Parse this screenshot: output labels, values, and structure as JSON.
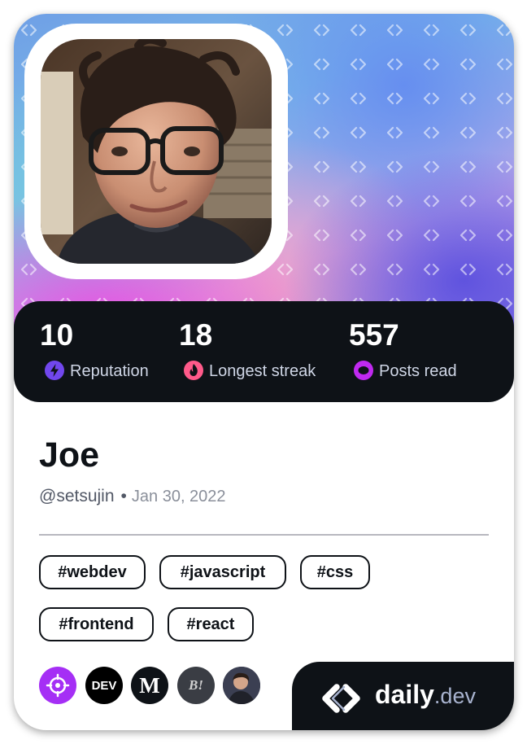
{
  "profile": {
    "name": "Joe",
    "handle": "@setsujin",
    "separator": "•",
    "joined": "Jan 30, 2022"
  },
  "stats": [
    {
      "value": "10",
      "label": "Reputation",
      "icon": "lightning-icon",
      "icon_color": "#7147ed"
    },
    {
      "value": "18",
      "label": "Longest streak",
      "icon": "flame-icon",
      "icon_color": "#ff5a8a"
    },
    {
      "value": "557",
      "label": "Posts read",
      "icon": "eye-ring-icon",
      "icon_color": "#c029f0"
    }
  ],
  "tags": [
    "#webdev",
    "#javascript",
    "#css",
    "#frontend",
    "#react"
  ],
  "sources": [
    {
      "name": "target-icon",
      "label": "",
      "bg": "#a52ff5"
    },
    {
      "name": "dev-icon",
      "label": "DEV",
      "bg": "#000000"
    },
    {
      "name": "medium-icon",
      "label": "M",
      "bg": "#0e1217"
    },
    {
      "name": "b-icon",
      "label": "B!",
      "bg": "#3a3d44"
    },
    {
      "name": "avatar-source-icon",
      "label": "",
      "bg": "#4a4f5c"
    }
  ],
  "brand": {
    "daily": "daily",
    "dev": ".dev"
  },
  "colors": {
    "card_dark": "#0e1217",
    "stats_label": "#cfd6e6"
  }
}
